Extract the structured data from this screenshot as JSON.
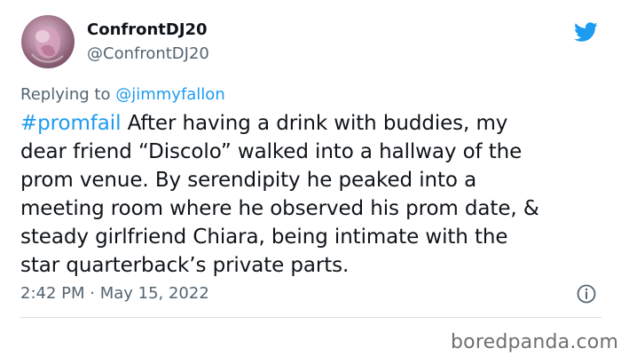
{
  "author": {
    "name": "ConfrontDJ20",
    "handle": "@ConfrontDJ20"
  },
  "reply": {
    "prefix": "Replying to",
    "target": "@jimmyfallon"
  },
  "tweet": {
    "hashtag": "#promfail",
    "body": " After having a drink with buddies, my\ndear friend “Discolo” walked into a hallway of the\nprom venue. By serendipity he peaked into a\nmeeting room where he observed his prom date, &\nsteady girlfriend Chiara, being intimate with the\nstar quarterback’s private parts."
  },
  "meta": {
    "timestamp": "2:42 PM · May 15, 2022"
  },
  "watermark": "boredpanda.com",
  "icons": {
    "brand": "twitter-bird-icon",
    "info": "info-icon"
  },
  "colors": {
    "accent": "#1d9bf0",
    "secondary_text": "#536471",
    "primary_text": "#0f1419"
  }
}
